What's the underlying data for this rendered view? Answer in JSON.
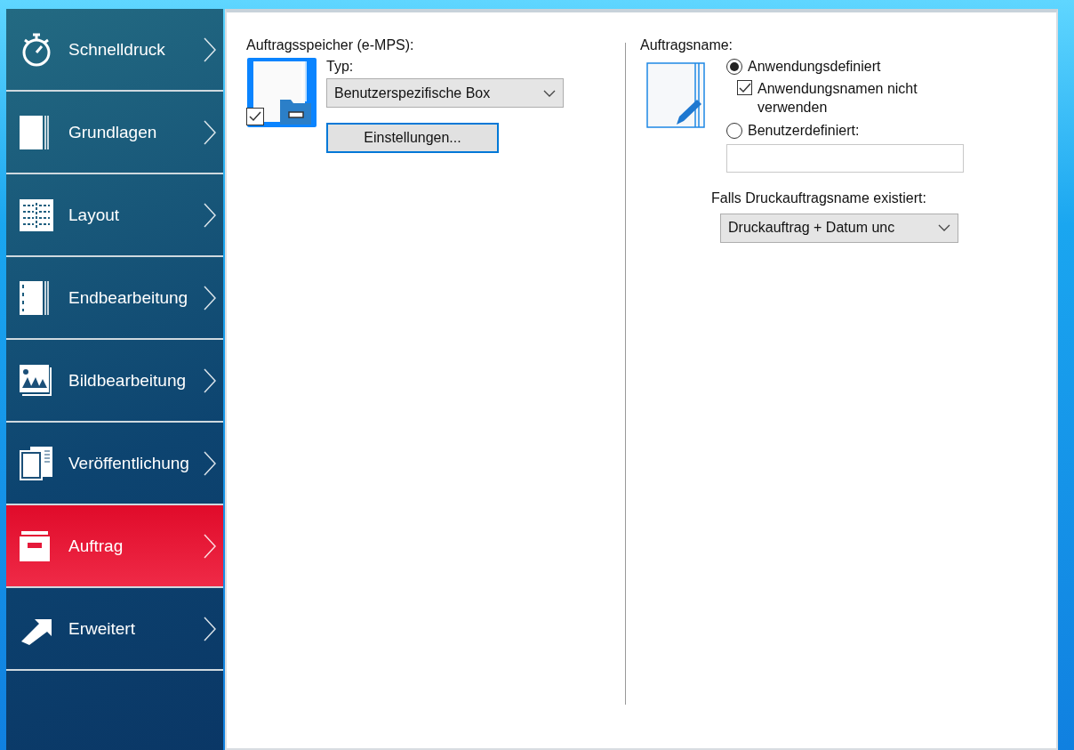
{
  "sidebar": {
    "items": [
      {
        "label": "Schnelldruck",
        "kind": "stopwatch",
        "selected": false
      },
      {
        "label": "Grundlagen",
        "kind": "page",
        "selected": false
      },
      {
        "label": "Layout",
        "kind": "layout",
        "selected": false
      },
      {
        "label": "Endbearbeitung",
        "kind": "finishing",
        "selected": false
      },
      {
        "label": "Bildbearbeitung",
        "kind": "image",
        "selected": false
      },
      {
        "label": "Veröffentlichung",
        "kind": "publish",
        "selected": false
      },
      {
        "label": "Auftrag",
        "kind": "job",
        "selected": true
      },
      {
        "label": "Erweitert",
        "kind": "arrow",
        "selected": false
      }
    ]
  },
  "job_storage": {
    "label": "Auftragsspeicher (e-MPS):",
    "checked": true,
    "type_label": "Typ:",
    "type_value": "Benutzerspezifische Box",
    "settings_button": "Einstellungen..."
  },
  "job_name": {
    "label": "Auftragsname:",
    "options": [
      {
        "label": "Anwendungsdefiniert",
        "selected": true
      },
      {
        "label": "Benutzerdefiniert:",
        "selected": false
      }
    ],
    "dont_use_app_name": {
      "label": "Anwendungsnamen nicht verwenden",
      "checked": true
    },
    "if_exists_label": "Falls Druckauftragsname existiert:",
    "if_exists_value": "Druckauftrag + Datum unc"
  }
}
